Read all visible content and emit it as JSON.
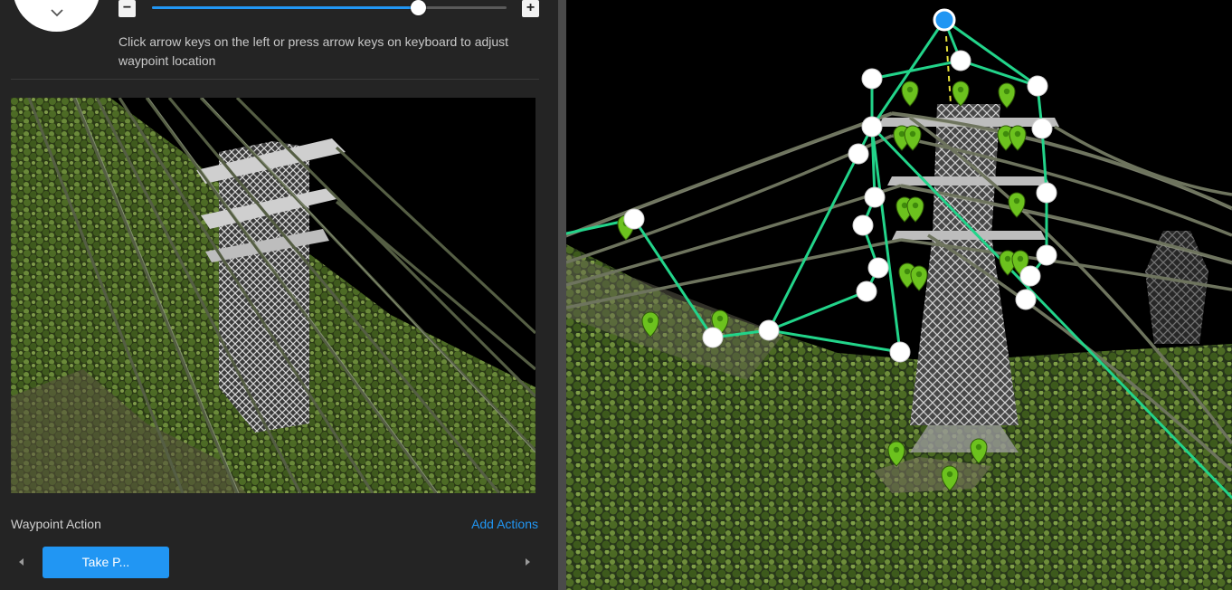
{
  "adjust": {
    "minus_label": "−",
    "plus_label": "+",
    "slider_fraction": 0.75,
    "instruction": "Click arrow keys on the left or press arrow keys on keyboard to adjust waypoint location"
  },
  "waypoint_panel": {
    "action_label": "Waypoint Action",
    "add_actions_label": "Add Actions",
    "actions": [
      "Take P..."
    ]
  },
  "colors": {
    "accent": "#2196f3",
    "route_line": "#22d48a",
    "waypoint_marker": "#6cc21e",
    "panel_bg": "#242424"
  },
  "icons": {
    "direction_pad_arrow": "chevron-down-icon",
    "waypoint": "map-pin-icon"
  }
}
